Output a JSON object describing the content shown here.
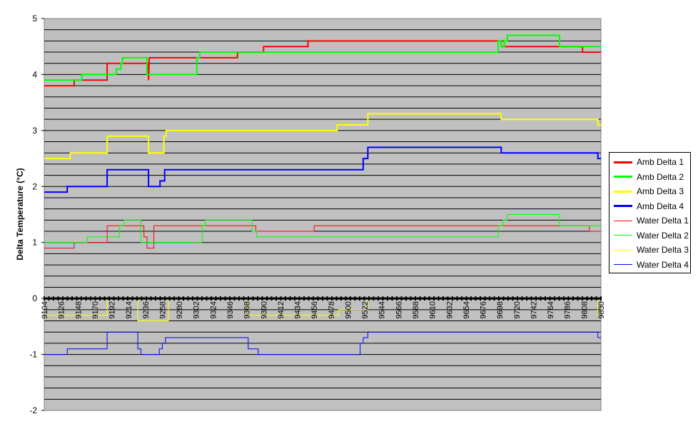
{
  "chart_data": {
    "type": "line",
    "title": "",
    "xlabel": "",
    "ylabel": "Delta Temperature (°C)",
    "ylim": [
      -2,
      5
    ],
    "yticks": [
      "-2",
      "-1",
      "0",
      "1",
      "2",
      "3",
      "4",
      "5"
    ],
    "grid": true,
    "legend_position": "right",
    "plot_background": "#c0c0c0",
    "x_categories": [
      "9104",
      "9126",
      "9148",
      "9170",
      "9192",
      "9214",
      "9236",
      "9258",
      "9280",
      "9302",
      "9324",
      "9346",
      "9368",
      "9390",
      "9412",
      "9434",
      "9456",
      "9478",
      "9500",
      "9522",
      "9544",
      "9566",
      "9588",
      "9610",
      "9632",
      "9654",
      "9676",
      "9698",
      "9720",
      "9742",
      "9764",
      "9786",
      "9808",
      "9830"
    ],
    "series": [
      {
        "name": "Amb Delta 1",
        "color": "#ff0000",
        "width": 2,
        "points": [
          [
            9104,
            3.8
          ],
          [
            9143,
            3.8
          ],
          [
            9143,
            3.9
          ],
          [
            9186,
            3.9
          ],
          [
            9186,
            4.2
          ],
          [
            9240,
            4.2
          ],
          [
            9240,
            3.9
          ],
          [
            9241,
            4.3
          ],
          [
            9356,
            4.3
          ],
          [
            9356,
            4.4
          ],
          [
            9390,
            4.4
          ],
          [
            9390,
            4.5
          ],
          [
            9448,
            4.5
          ],
          [
            9448,
            4.6
          ],
          [
            9700,
            4.6
          ],
          [
            9700,
            4.5
          ],
          [
            9806,
            4.5
          ],
          [
            9806,
            4.4
          ],
          [
            9830,
            4.4
          ]
        ]
      },
      {
        "name": "Amb Delta 2",
        "color": "#00ff00",
        "width": 2,
        "points": [
          [
            9104,
            3.9
          ],
          [
            9153,
            3.9
          ],
          [
            9153,
            4.0
          ],
          [
            9198,
            4.0
          ],
          [
            9198,
            4.1
          ],
          [
            9204,
            4.1
          ],
          [
            9204,
            4.2
          ],
          [
            9206,
            4.2
          ],
          [
            9206,
            4.3
          ],
          [
            9238,
            4.3
          ],
          [
            9238,
            4.0
          ],
          [
            9303,
            4.0
          ],
          [
            9303,
            4.3
          ],
          [
            9307,
            4.3
          ],
          [
            9307,
            4.4
          ],
          [
            9696,
            4.4
          ],
          [
            9696,
            4.6
          ],
          [
            9700,
            4.6
          ],
          [
            9700,
            4.5
          ],
          [
            9704,
            4.5
          ],
          [
            9704,
            4.6
          ],
          [
            9708,
            4.6
          ],
          [
            9708,
            4.7
          ],
          [
            9776,
            4.7
          ],
          [
            9776,
            4.5
          ],
          [
            9830,
            4.5
          ]
        ]
      },
      {
        "name": "Amb Delta 3",
        "color": "#ffff00",
        "width": 2,
        "points": [
          [
            9104,
            2.5
          ],
          [
            9138,
            2.5
          ],
          [
            9138,
            2.6
          ],
          [
            9186,
            2.6
          ],
          [
            9186,
            2.9
          ],
          [
            9240,
            2.9
          ],
          [
            9240,
            2.6
          ],
          [
            9260,
            2.6
          ],
          [
            9260,
            2.9
          ],
          [
            9263,
            2.9
          ],
          [
            9263,
            3.0
          ],
          [
            9486,
            3.0
          ],
          [
            9486,
            3.1
          ],
          [
            9526,
            3.1
          ],
          [
            9526,
            3.3
          ],
          [
            9700,
            3.3
          ],
          [
            9700,
            3.2
          ],
          [
            9826,
            3.2
          ],
          [
            9826,
            3.1
          ],
          [
            9830,
            3.1
          ]
        ]
      },
      {
        "name": "Amb Delta 4",
        "color": "#0000ff",
        "width": 2,
        "points": [
          [
            9104,
            1.9
          ],
          [
            9134,
            1.9
          ],
          [
            9134,
            2.0
          ],
          [
            9186,
            2.0
          ],
          [
            9186,
            2.3
          ],
          [
            9240,
            2.3
          ],
          [
            9240,
            2.0
          ],
          [
            9255,
            2.0
          ],
          [
            9255,
            2.1
          ],
          [
            9261,
            2.1
          ],
          [
            9261,
            2.3
          ],
          [
            9520,
            2.3
          ],
          [
            9520,
            2.5
          ],
          [
            9526,
            2.5
          ],
          [
            9526,
            2.7
          ],
          [
            9700,
            2.7
          ],
          [
            9700,
            2.6
          ],
          [
            9826,
            2.6
          ],
          [
            9826,
            2.5
          ],
          [
            9830,
            2.5
          ]
        ]
      },
      {
        "name": "Water Delta 1",
        "color": "#ff0000",
        "width": 1,
        "points": [
          [
            9104,
            0.9
          ],
          [
            9143,
            0.9
          ],
          [
            9143,
            1.0
          ],
          [
            9186,
            1.0
          ],
          [
            9186,
            1.3
          ],
          [
            9234,
            1.3
          ],
          [
            9234,
            1.1
          ],
          [
            9238,
            1.1
          ],
          [
            9238,
            0.9
          ],
          [
            9247,
            0.9
          ],
          [
            9247,
            1.3
          ],
          [
            9380,
            1.3
          ],
          [
            9380,
            1.2
          ],
          [
            9396,
            1.2
          ],
          [
            9396,
            1.2
          ],
          [
            9456,
            1.2
          ],
          [
            9456,
            1.3
          ],
          [
            9698,
            1.3
          ],
          [
            9698,
            1.3
          ],
          [
            9815,
            1.3
          ],
          [
            9815,
            1.2
          ],
          [
            9830,
            1.2
          ]
        ]
      },
      {
        "name": "Water Delta 2",
        "color": "#00ff00",
        "width": 1,
        "points": [
          [
            9104,
            1.0
          ],
          [
            9160,
            1.0
          ],
          [
            9160,
            1.1
          ],
          [
            9202,
            1.1
          ],
          [
            9202,
            1.3
          ],
          [
            9208,
            1.3
          ],
          [
            9208,
            1.4
          ],
          [
            9230,
            1.4
          ],
          [
            9230,
            1.0
          ],
          [
            9310,
            1.0
          ],
          [
            9310,
            1.3
          ],
          [
            9314,
            1.3
          ],
          [
            9314,
            1.4
          ],
          [
            9375,
            1.4
          ],
          [
            9375,
            1.2
          ],
          [
            9381,
            1.2
          ],
          [
            9381,
            1.1
          ],
          [
            9696,
            1.1
          ],
          [
            9696,
            1.3
          ],
          [
            9702,
            1.3
          ],
          [
            9702,
            1.4
          ],
          [
            9708,
            1.4
          ],
          [
            9708,
            1.5
          ],
          [
            9776,
            1.5
          ],
          [
            9776,
            1.3
          ],
          [
            9830,
            1.3
          ]
        ]
      },
      {
        "name": "Water Delta 3",
        "color": "#ffff00",
        "width": 1,
        "points": [
          [
            9104,
            -0.3
          ],
          [
            9186,
            -0.3
          ],
          [
            9186,
            0.0
          ],
          [
            9226,
            0.0
          ],
          [
            9226,
            -0.4
          ],
          [
            9266,
            -0.4
          ],
          [
            9266,
            0.0
          ],
          [
            9371,
            0.0
          ],
          [
            9371,
            -0.3
          ],
          [
            9488,
            -0.3
          ],
          [
            9488,
            -0.2
          ],
          [
            9526,
            -0.2
          ],
          [
            9526,
            0.0
          ],
          [
            9826,
            0.0
          ],
          [
            9826,
            -0.3
          ],
          [
            9830,
            -0.3
          ]
        ]
      },
      {
        "name": "Water Delta 4",
        "color": "#0000ff",
        "width": 1,
        "points": [
          [
            9104,
            -1.0
          ],
          [
            9134,
            -1.0
          ],
          [
            9134,
            -0.9
          ],
          [
            9186,
            -0.9
          ],
          [
            9186,
            -0.6
          ],
          [
            9226,
            -0.6
          ],
          [
            9226,
            -0.9
          ],
          [
            9230,
            -0.9
          ],
          [
            9230,
            -1.0
          ],
          [
            9254,
            -1.0
          ],
          [
            9254,
            -0.9
          ],
          [
            9258,
            -0.9
          ],
          [
            9258,
            -0.8
          ],
          [
            9262,
            -0.8
          ],
          [
            9262,
            -0.7
          ],
          [
            9370,
            -0.7
          ],
          [
            9370,
            -0.9
          ],
          [
            9383,
            -0.9
          ],
          [
            9383,
            -1.0
          ],
          [
            9516,
            -1.0
          ],
          [
            9516,
            -0.8
          ],
          [
            9520,
            -0.8
          ],
          [
            9520,
            -0.7
          ],
          [
            9526,
            -0.7
          ],
          [
            9526,
            -0.6
          ],
          [
            9826,
            -0.6
          ],
          [
            9826,
            -0.7
          ],
          [
            9830,
            -0.7
          ]
        ]
      }
    ]
  }
}
